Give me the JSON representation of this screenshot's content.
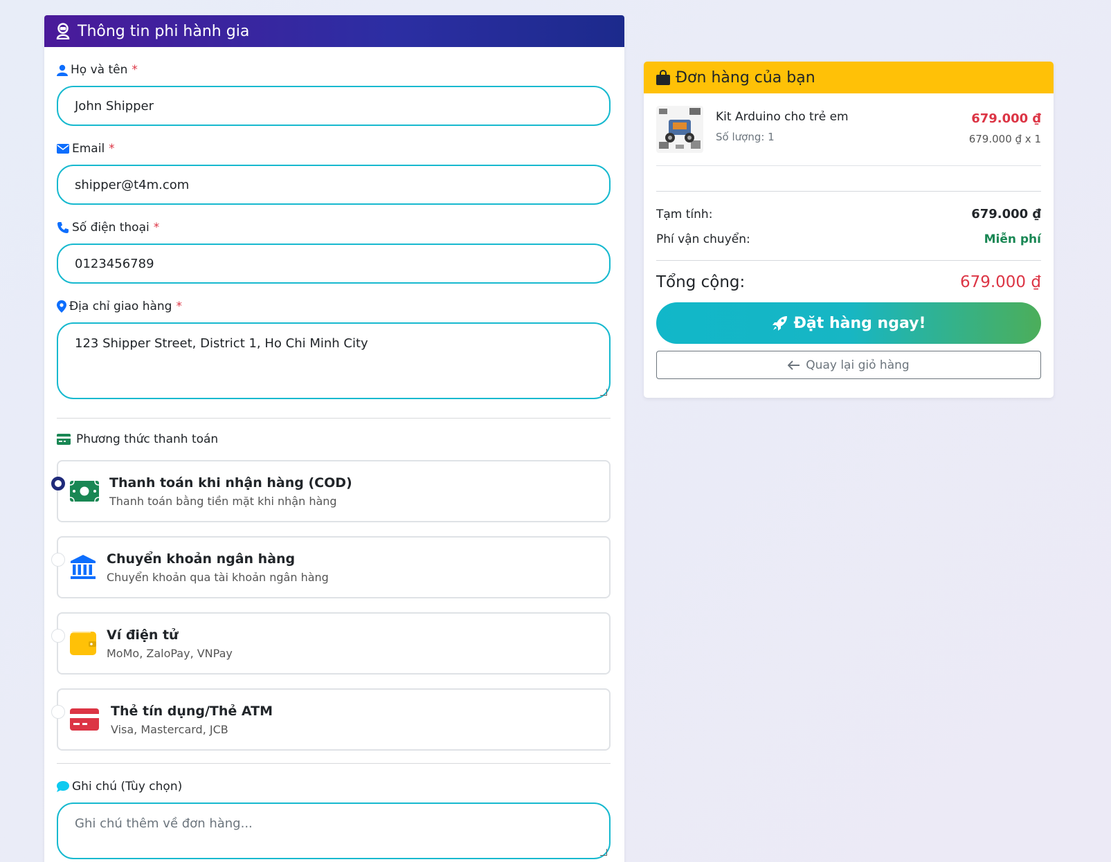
{
  "left_card": {
    "title": "Thông tin phi hành gia",
    "fields": {
      "name": {
        "label": "Họ và tên",
        "required": "*",
        "value": "John Shipper"
      },
      "email": {
        "label": "Email",
        "required": "*",
        "value": "shipper@t4m.com"
      },
      "phone": {
        "label": "Số điện thoại",
        "required": "*",
        "value": "0123456789"
      },
      "address": {
        "label": "Địa chỉ giao hàng",
        "required": "*",
        "value": "123 Shipper Street, District 1, Ho Chi Minh City"
      }
    },
    "payment": {
      "title": "Phương thức thanh toán",
      "options": [
        {
          "title": "Thanh toán khi nhận hàng (COD)",
          "subtitle": "Thanh toán bằng tiền mặt khi nhận hàng",
          "icon": "money-bill-icon",
          "color": "#198754",
          "checked": true
        },
        {
          "title": "Chuyển khoản ngân hàng",
          "subtitle": "Chuyển khoản qua tài khoản ngân hàng",
          "icon": "bank-icon",
          "color": "#0d6efd",
          "checked": false
        },
        {
          "title": "Ví điện tử",
          "subtitle": "MoMo, ZaloPay, VNPay",
          "icon": "wallet-icon",
          "color": "#ffc107",
          "checked": false
        },
        {
          "title": "Thẻ tín dụng/Thẻ ATM",
          "subtitle": "Visa, Mastercard, JCB",
          "icon": "credit-card-icon",
          "color": "#dc3545",
          "checked": false
        }
      ]
    },
    "note": {
      "label": "Ghi chú (Tùy chọn)",
      "placeholder": "Ghi chú thêm về đơn hàng..."
    }
  },
  "order": {
    "title": "Đơn hàng của bạn",
    "item": {
      "name": "Kit Arduino cho trẻ em",
      "qty_label": "Số lượng: 1",
      "price": "679.000 ₫",
      "unit_line": "679.000 ₫ x 1"
    },
    "subtotal_label": "Tạm tính:",
    "subtotal_value": "679.000 ₫",
    "shipping_label": "Phí vận chuyển:",
    "shipping_value": "Miễn phí",
    "total_label": "Tổng cộng:",
    "total_value": "679.000 ₫",
    "order_button": "Đặt hàng ngay!",
    "back_button": "Quay lại giỏ hàng"
  },
  "colors": {
    "accent_input_border": "#17b9cf",
    "header_gradient_start": "#4a1a9a",
    "order_header": "#ffc107",
    "price_red": "#dc3545",
    "free_green": "#198754"
  }
}
